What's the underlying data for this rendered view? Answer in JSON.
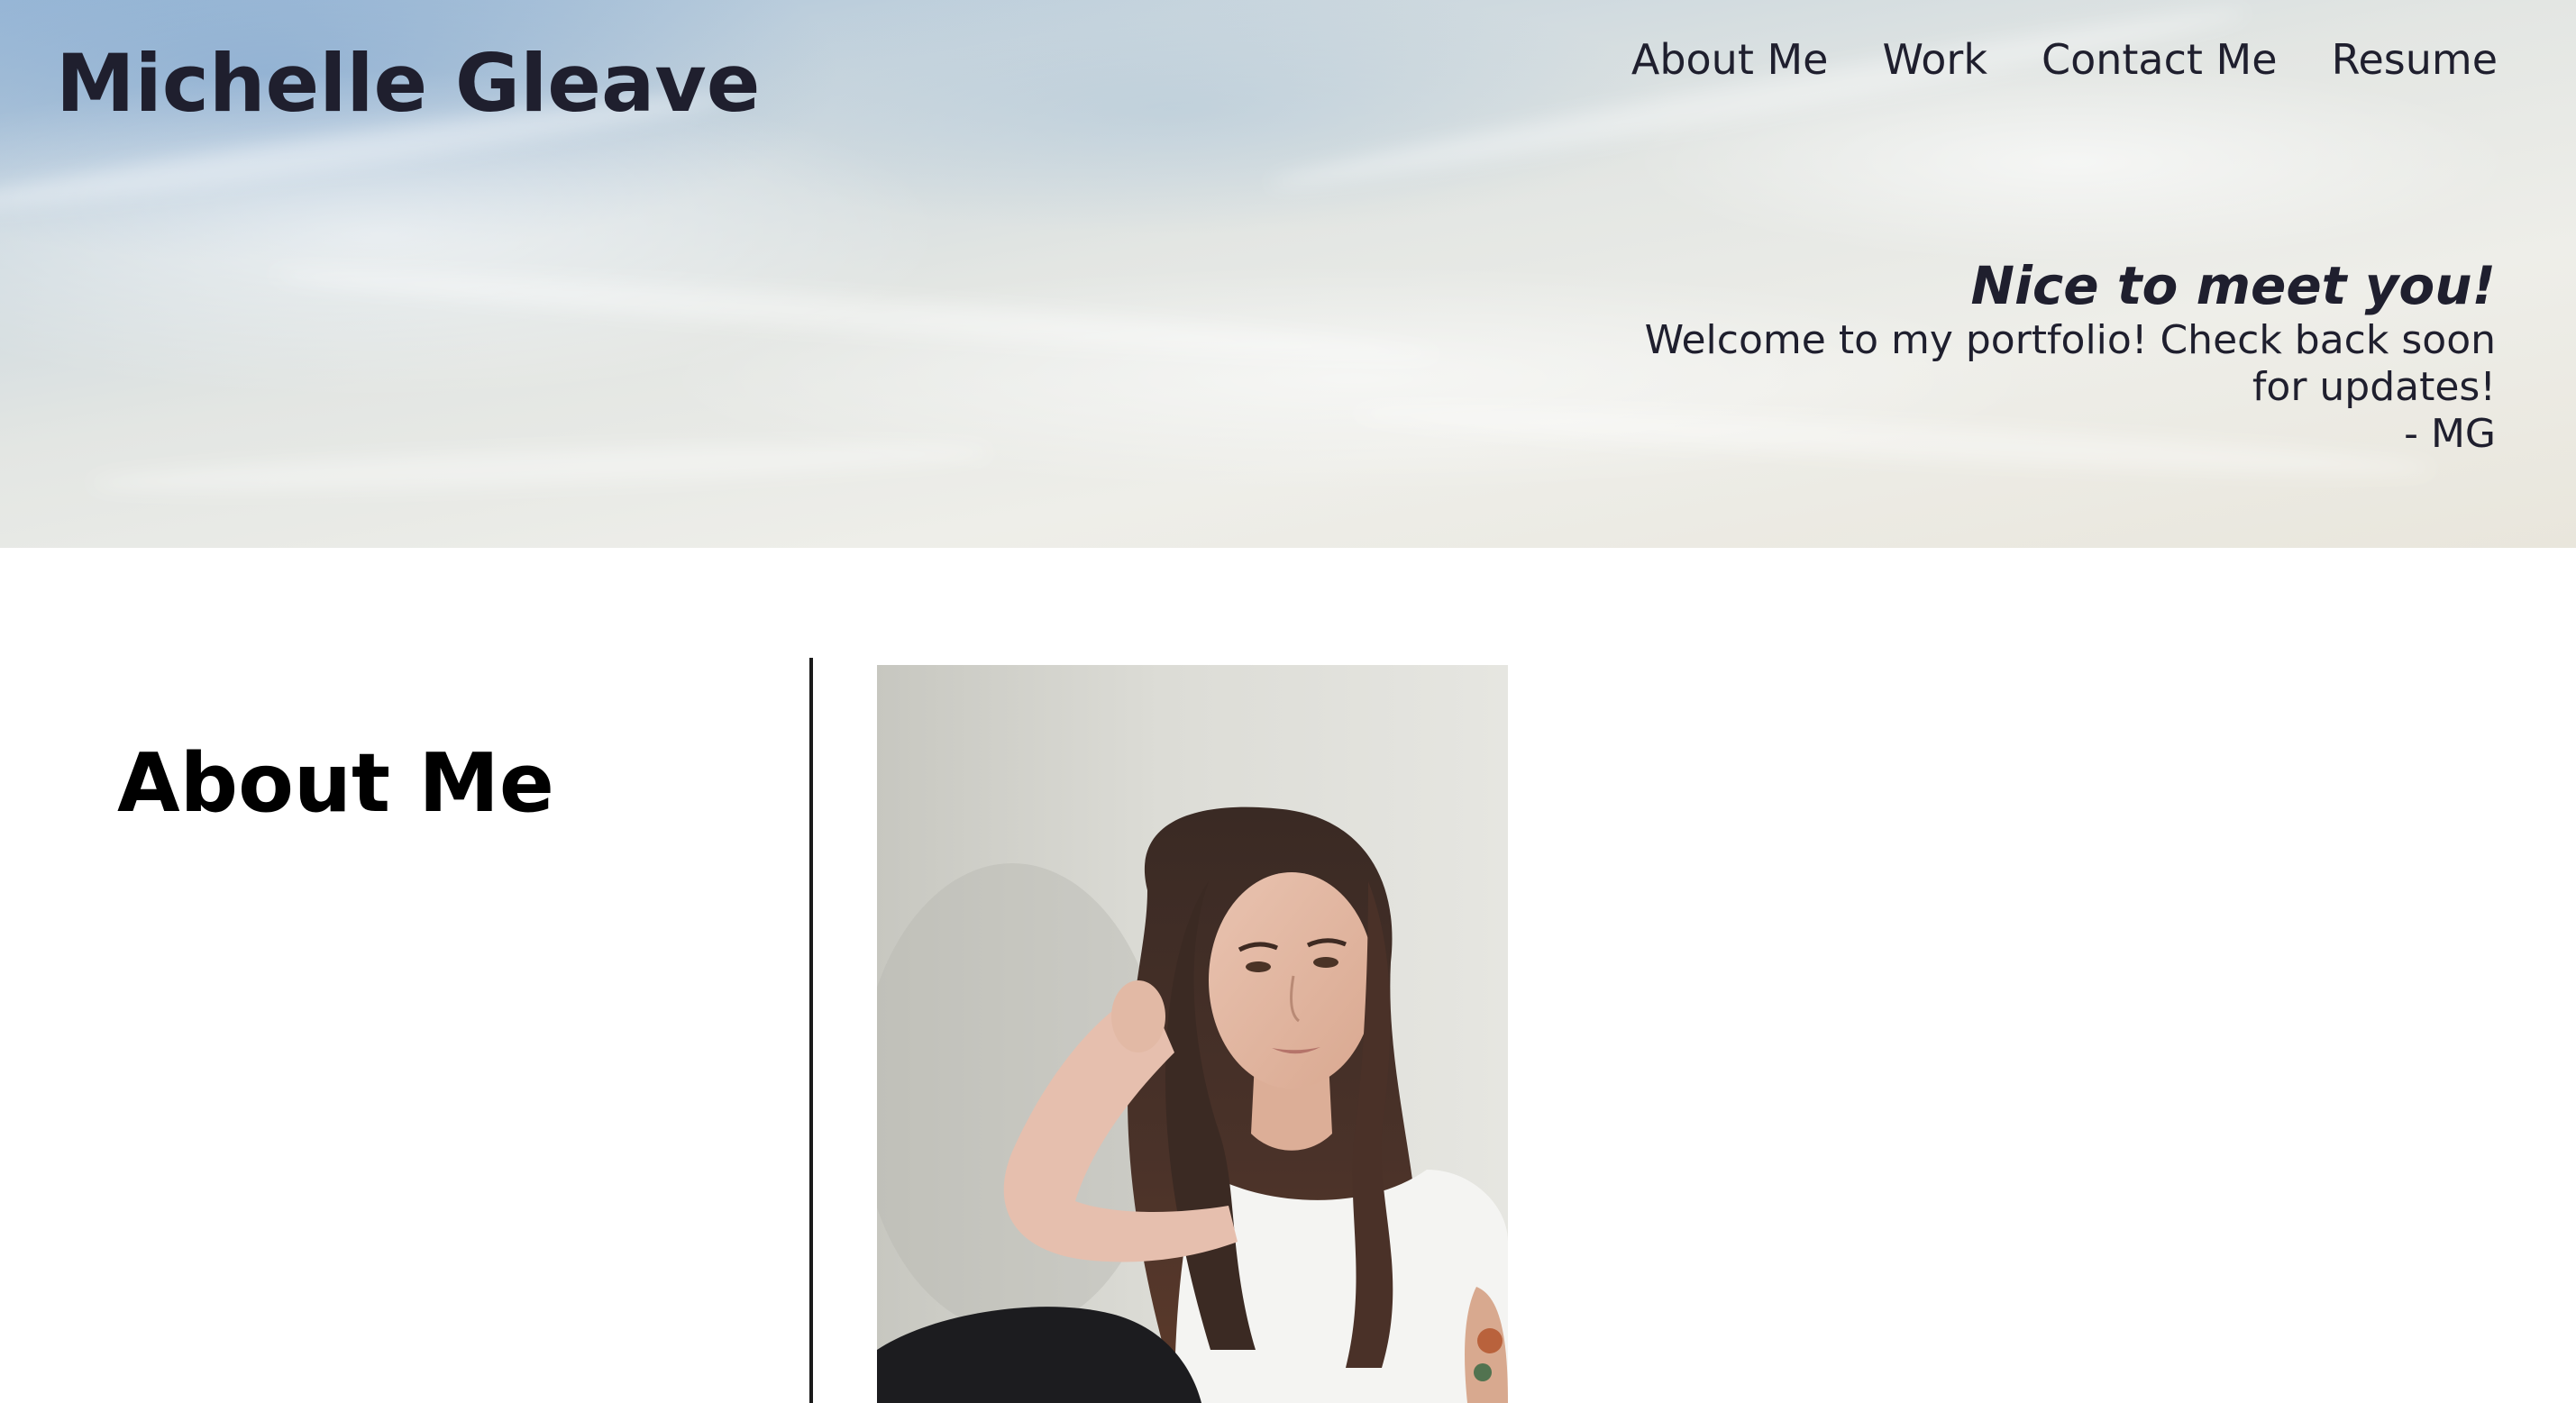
{
  "header": {
    "site_title": "Michelle Gleave",
    "nav": [
      {
        "label": "About Me"
      },
      {
        "label": "Work"
      },
      {
        "label": "Contact Me"
      },
      {
        "label": "Resume"
      }
    ]
  },
  "hero": {
    "greeting_heading": "Nice to meet you!",
    "greeting_line1": "Welcome to my portfolio! Check back soon",
    "greeting_line2": "for updates!",
    "signature": "- MG"
  },
  "about": {
    "heading": "About Me",
    "photo_alt": "Portrait of Michelle Gleave"
  },
  "colors": {
    "text_dark": "#1f1f2e",
    "sky_blue": "#9fbcd8",
    "divider": "#1a1a1a",
    "background": "#ffffff"
  }
}
